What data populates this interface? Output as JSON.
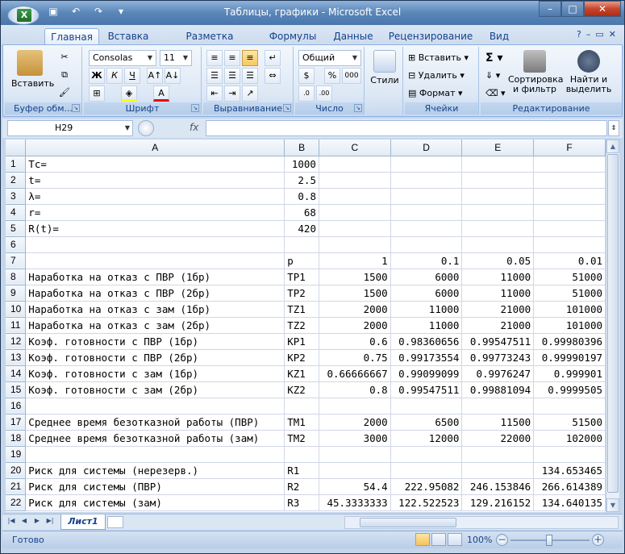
{
  "window": {
    "title": "Таблицы, графики - Microsoft Excel",
    "app_icon": "excel-logo-icon",
    "minimize": "–",
    "maximize": "□",
    "close": "✕"
  },
  "tabs": [
    {
      "label": "Главная",
      "active": true
    },
    {
      "label": "Вставка"
    },
    {
      "label": "Разметка страницы"
    },
    {
      "label": "Формулы"
    },
    {
      "label": "Данные"
    },
    {
      "label": "Рецензирование"
    },
    {
      "label": "Вид"
    }
  ],
  "ribbon": {
    "clipboard": {
      "label": "Буфер обм...",
      "paste": "Вставить"
    },
    "font": {
      "label": "Шрифт",
      "font_name": "Consolas",
      "font_size": "11",
      "bold": "Ж",
      "italic": "К",
      "underline": "Ч"
    },
    "alignment": {
      "label": "Выравнивание"
    },
    "number": {
      "label": "Число",
      "format": "Общий",
      "percent": "%",
      "currency": "$",
      "thousands": "000"
    },
    "styles": {
      "label": "Стили"
    },
    "cells": {
      "label": "Ячейки",
      "insert": "Вставить",
      "delete": "Удалить",
      "format": "Формат"
    },
    "editing": {
      "label": "Редактирование",
      "sort": "Сортировка и фильтр",
      "sort_l1": "Сортировка",
      "sort_l2": "и фильтр",
      "find": "Найти и выделить",
      "find_l1": "Найти и",
      "find_l2": "выделить",
      "sum": "Σ"
    }
  },
  "formula_bar": {
    "cell_ref": "H29",
    "fx": "fx",
    "value": ""
  },
  "sheet": {
    "columns": [
      "A",
      "B",
      "C",
      "D",
      "E",
      "F"
    ],
    "rows": [
      {
        "n": "1",
        "cells": [
          "Tc=",
          "1000",
          "",
          "",
          "",
          ""
        ]
      },
      {
        "n": "2",
        "cells": [
          "t=",
          "2.5",
          "",
          "",
          "",
          ""
        ]
      },
      {
        "n": "3",
        "cells": [
          "λ=",
          "0.8",
          "",
          "",
          "",
          ""
        ]
      },
      {
        "n": "4",
        "cells": [
          "r=",
          "68",
          "",
          "",
          "",
          ""
        ]
      },
      {
        "n": "5",
        "cells": [
          "R(t)=",
          "420",
          "",
          "",
          "",
          ""
        ]
      },
      {
        "n": "6",
        "cells": [
          "",
          "",
          "",
          "",
          "",
          ""
        ]
      },
      {
        "n": "7",
        "cells": [
          "",
          "p",
          "1",
          "0.1",
          "0.05",
          "0.01"
        ]
      },
      {
        "n": "8",
        "cells": [
          "Наработка на отказ с ПВР (1бр)",
          "TP1",
          "1500",
          "6000",
          "11000",
          "51000"
        ]
      },
      {
        "n": "9",
        "cells": [
          "Наработка на отказ с ПВР (2бр)",
          "TP2",
          "1500",
          "6000",
          "11000",
          "51000"
        ]
      },
      {
        "n": "10",
        "cells": [
          "Наработка на отказ с зам (1бр)",
          "TZ1",
          "2000",
          "11000",
          "21000",
          "101000"
        ]
      },
      {
        "n": "11",
        "cells": [
          "Наработка на отказ с зам (2бр)",
          "TZ2",
          "2000",
          "11000",
          "21000",
          "101000"
        ]
      },
      {
        "n": "12",
        "cells": [
          "Коэф. готовности с ПВР (1бр)",
          "KP1",
          "0.6",
          "0.98360656",
          "0.99547511",
          "0.99980396"
        ]
      },
      {
        "n": "13",
        "cells": [
          "Коэф. готовности с ПВР (2бр)",
          "KP2",
          "0.75",
          "0.99173554",
          "0.99773243",
          "0.99990197"
        ]
      },
      {
        "n": "14",
        "cells": [
          "Коэф. готовности с зам (1бр)",
          "KZ1",
          "0.66666667",
          "0.99099099",
          "0.9976247",
          "0.999901"
        ]
      },
      {
        "n": "15",
        "cells": [
          "Коэф. готовности с зам (2бр)",
          "KZ2",
          "0.8",
          "0.99547511",
          "0.99881094",
          "0.9999505"
        ]
      },
      {
        "n": "16",
        "cells": [
          "",
          "",
          "",
          "",
          "",
          ""
        ]
      },
      {
        "n": "17",
        "cells": [
          "Среднее время безотказной работы (ПВР)",
          "TM1",
          "2000",
          "6500",
          "11500",
          "51500"
        ]
      },
      {
        "n": "18",
        "cells": [
          "Среднее время безотказной работы (зам)",
          "TM2",
          "3000",
          "12000",
          "22000",
          "102000"
        ]
      },
      {
        "n": "19",
        "cells": [
          "",
          "",
          "",
          "",
          "",
          ""
        ]
      },
      {
        "n": "20",
        "cells": [
          "Риск для системы (нерезерв.)",
          "R1",
          "",
          "",
          "",
          "134.653465"
        ]
      },
      {
        "n": "21",
        "cells": [
          "Риск для системы (ПВР)",
          "R2",
          "54.4",
          "222.95082",
          "246.153846",
          "266.614389"
        ]
      },
      {
        "n": "22",
        "cells": [
          "Риск для системы (зам)",
          "R3",
          "45.3333333",
          "122.522523",
          "129.216152",
          "134.640135"
        ]
      }
    ]
  },
  "sheet_tabs": [
    {
      "label": "Лист1",
      "active": true
    }
  ],
  "status": {
    "ready": "Готово",
    "zoom": "100%",
    "zoom_minus": "−",
    "zoom_plus": "+"
  }
}
